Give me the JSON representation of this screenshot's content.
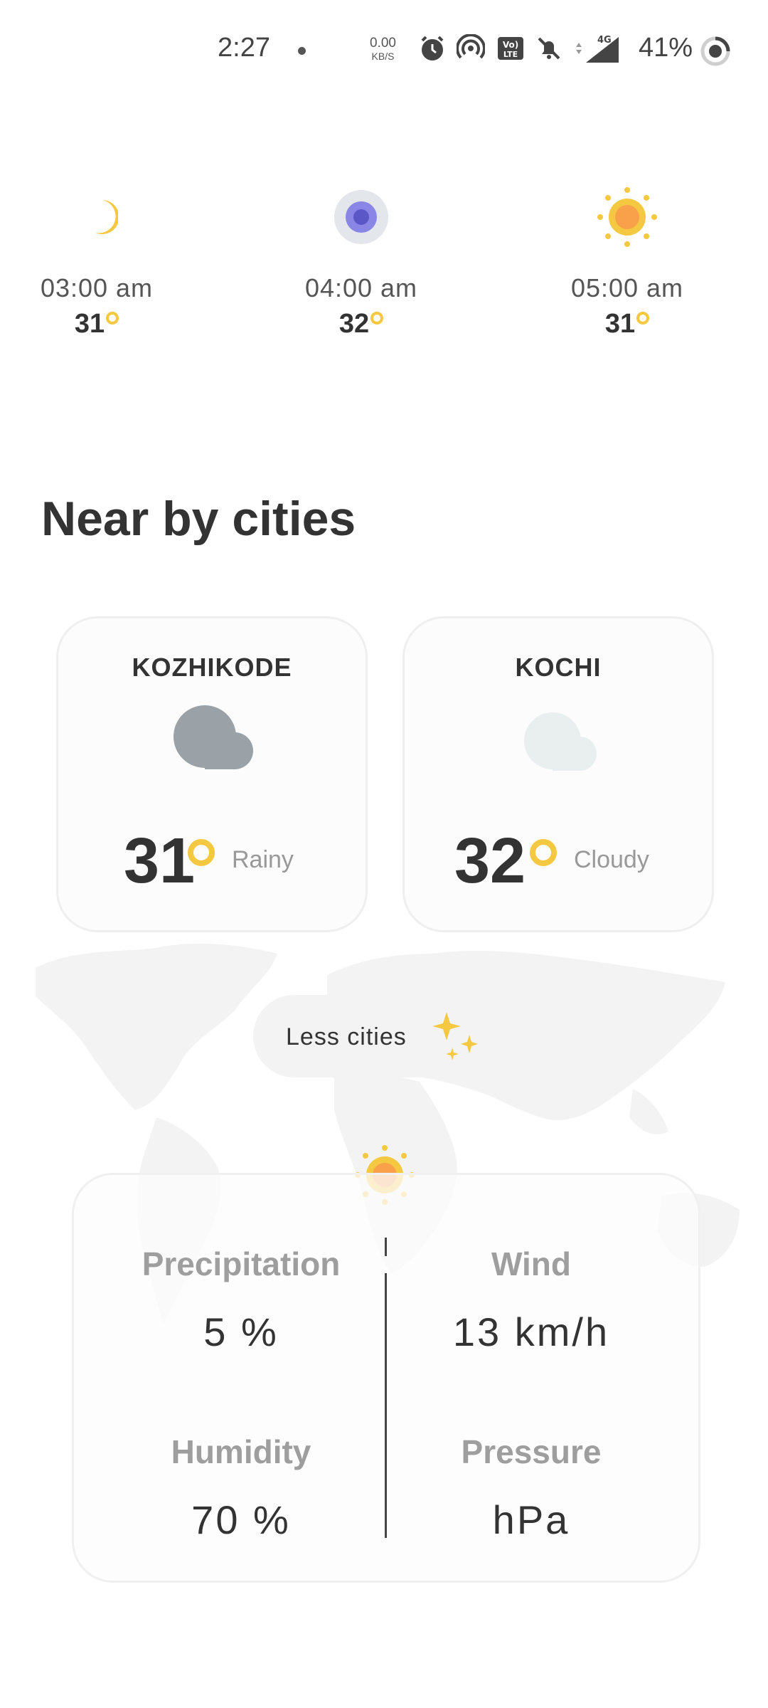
{
  "status_bar": {
    "time": "2:27",
    "net_speed_value": "0.00",
    "net_speed_unit": "KB/S",
    "network": "4G",
    "battery": "41%"
  },
  "hourly": [
    {
      "time": "03:00 am",
      "temp": "31",
      "icon": "moon-icon"
    },
    {
      "time": "04:00 am",
      "temp": "32",
      "icon": "night-cloud-icon"
    },
    {
      "time": "05:00 am",
      "temp": "31",
      "icon": "sun-icon"
    }
  ],
  "nearby": {
    "title": "Near by cities",
    "cities": [
      {
        "name": "KOZHIKODE",
        "temp": "31",
        "condition": "Rainy",
        "icon": "cloud-icon"
      },
      {
        "name": "KOCHI",
        "temp": "32",
        "condition": "Cloudy",
        "icon": "cloud-icon"
      }
    ],
    "toggle_label": "Less cities"
  },
  "details": {
    "precipitation_label": "Precipitation",
    "precipitation_value": "5 %",
    "wind_label": "Wind",
    "wind_value": "13 km/h",
    "humidity_label": "Humidity",
    "humidity_value": "70 %",
    "pressure_label": "Pressure",
    "pressure_value": "hPa"
  },
  "colors": {
    "accent_yellow": "#f5c842",
    "sun_orange": "#f9a04b",
    "rain_cloud": "#9aa2a7",
    "light_cloud": "#e9eeee",
    "night_cloud_purple": "#7b78d6"
  }
}
